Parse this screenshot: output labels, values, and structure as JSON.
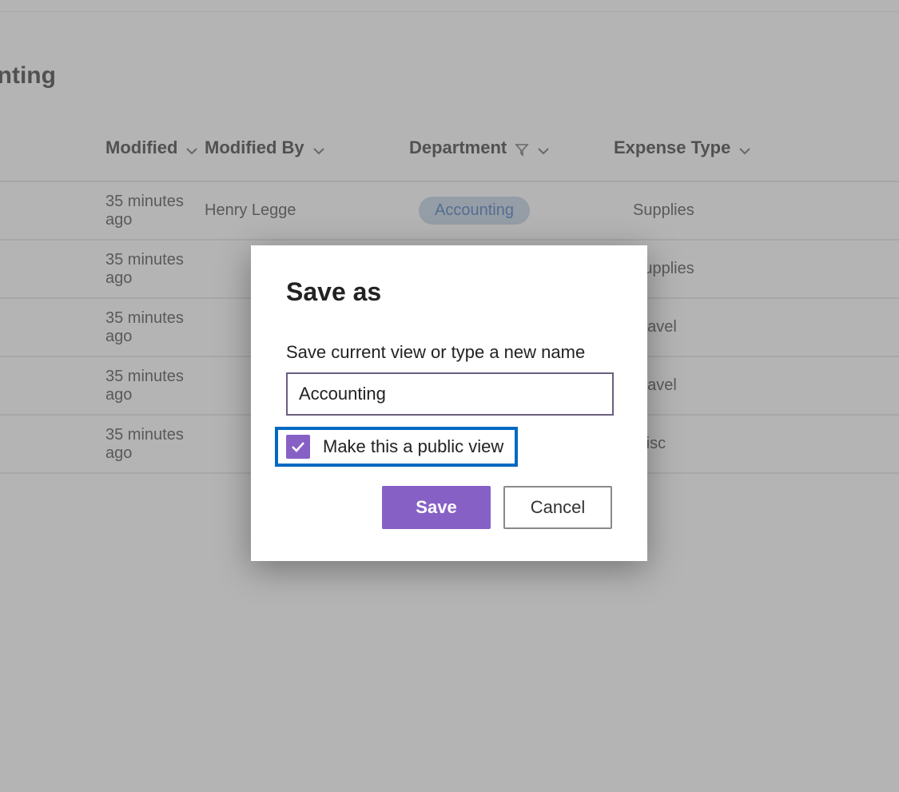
{
  "viewTitle": "ounting",
  "columns": {
    "modified": "Modified",
    "modifiedBy": "Modified By",
    "department": "Department",
    "expenseType": "Expense Type"
  },
  "rows": [
    {
      "modified": "35 minutes ago",
      "modifiedBy": "Henry Legge",
      "department": "Accounting",
      "expense": "Supplies"
    },
    {
      "modified": "35 minutes ago",
      "modifiedBy": "",
      "department": "",
      "expense": "Supplies"
    },
    {
      "modified": "35 minutes ago",
      "modifiedBy": "",
      "department": "",
      "expense": "Travel"
    },
    {
      "modified": "35 minutes ago",
      "modifiedBy": "",
      "department": "",
      "expense": "Travel"
    },
    {
      "modified": "35 minutes ago",
      "modifiedBy": "",
      "department": "",
      "expense": "Misc"
    }
  ],
  "dialog": {
    "title": "Save as",
    "prompt": "Save current view or type a new name",
    "inputValue": "Accounting",
    "checkboxLabel": "Make this a public view",
    "checkboxChecked": true,
    "saveLabel": "Save",
    "cancelLabel": "Cancel"
  },
  "colors": {
    "accent": "#8760c6",
    "highlight": "#0169c1",
    "pillBg": "#b8cade",
    "pillText": "#2a5fb0"
  }
}
